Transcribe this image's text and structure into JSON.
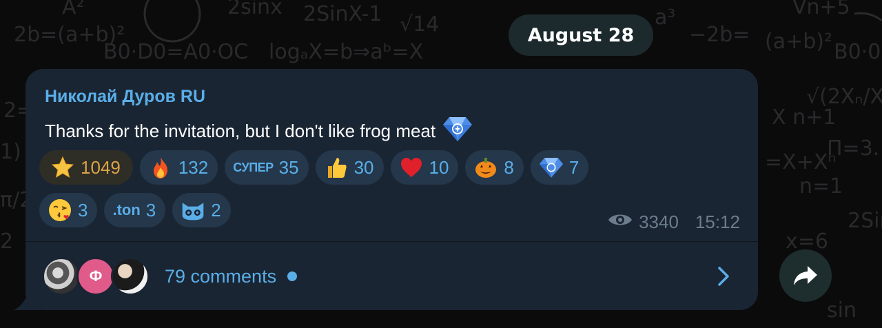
{
  "date_label": "August 28",
  "message": {
    "sender": "Николай Дуров RU",
    "text": "Thanks for the invitation, but I don't like frog meat",
    "text_emoji": "gem-icon"
  },
  "reactions": [
    {
      "icon": "star-icon",
      "count": "1049"
    },
    {
      "icon": "fire-icon",
      "count": "132"
    },
    {
      "icon": "super-tag",
      "label": "СУПЕР",
      "count": "35"
    },
    {
      "icon": "thumbs-up-icon",
      "count": "30"
    },
    {
      "icon": "heart-icon",
      "count": "10"
    },
    {
      "icon": "pumpkin-icon",
      "count": "8"
    },
    {
      "icon": "gem-icon",
      "count": "7"
    },
    {
      "icon": "kiss-face-icon",
      "count": "3"
    },
    {
      "icon": "ton-tag",
      "label": ".ton",
      "count": "3"
    },
    {
      "icon": "cat-face-icon",
      "count": "2"
    }
  ],
  "meta": {
    "views": "3340",
    "time": "15:12"
  },
  "comments": {
    "label": "79 comments",
    "avatar_letter": "Ф"
  },
  "colors": {
    "bubble": "#1a2533",
    "accent": "#5aaee8",
    "star_reaction_bg": "#2e2d26",
    "star_text": "#d9a44a"
  }
}
